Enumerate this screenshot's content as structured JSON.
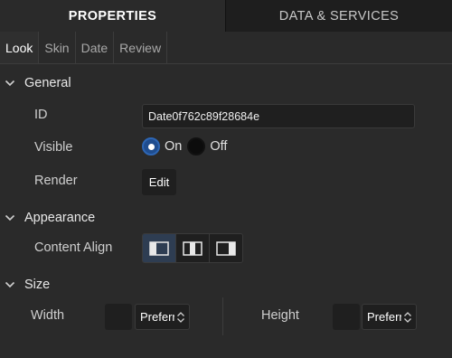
{
  "top_tabs": {
    "properties": "PROPERTIES",
    "data_services": "DATA & SERVICES"
  },
  "sub_tabs": [
    "Look",
    "Skin",
    "Date",
    "Review"
  ],
  "sections": {
    "general": "General",
    "appearance": "Appearance",
    "size": "Size"
  },
  "general": {
    "id_label": "ID",
    "id_value": "Date0f762c89f28684e",
    "visible_label": "Visible",
    "visible_on": "On",
    "visible_off": "Off",
    "visible_selected": "On",
    "render_label": "Render",
    "render_button": "Edit"
  },
  "appearance": {
    "content_align_label": "Content Align",
    "align_options": [
      "align-left-icon",
      "align-center-icon",
      "align-right-icon"
    ],
    "align_selected": "align-left-icon"
  },
  "size": {
    "width_label": "Width",
    "width_value": "",
    "width_unit": "Preferred",
    "height_label": "Height",
    "height_value": "",
    "height_unit": "Preferred"
  },
  "colors": {
    "background": "#2a2a2a",
    "tab_bar": "#1c1c1c",
    "radio_selected": "#1f4d8f",
    "input_bg": "#1f1f1f"
  }
}
